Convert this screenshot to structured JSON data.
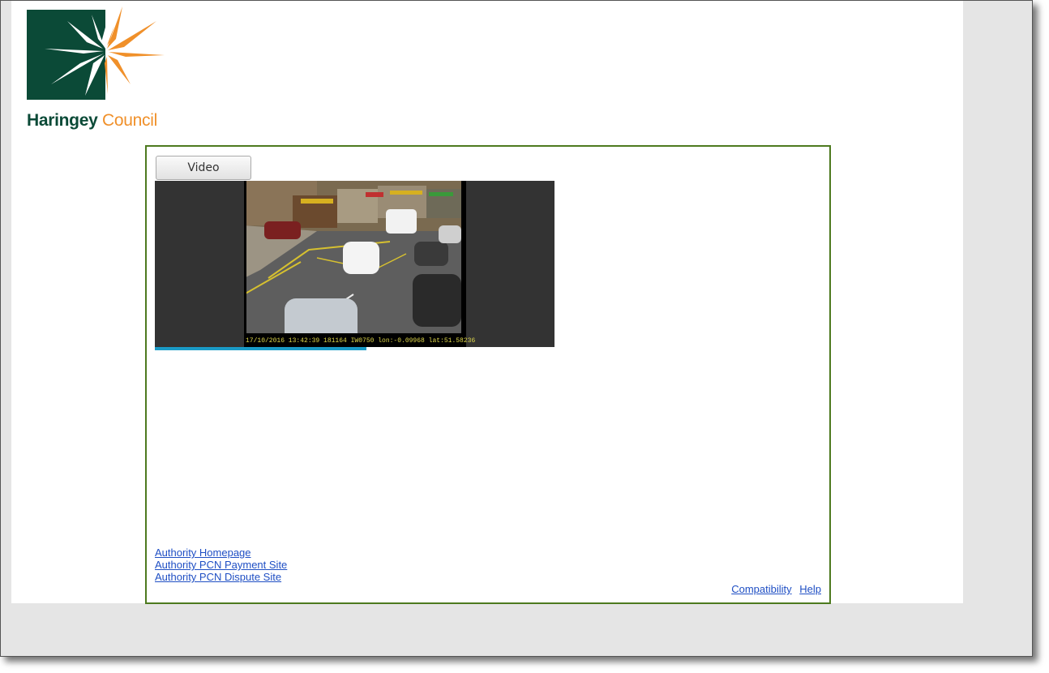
{
  "brand": {
    "name_part1": "Haringey",
    "name_part2": "Council",
    "colors": {
      "dark_green": "#0b4a37",
      "orange": "#f0902a",
      "panel_border": "#4d7a1f"
    }
  },
  "media": {
    "tab_label": "Video",
    "overlay_text": "17/10/2016 13:42:39 181164 IW0750 lon:-0.09968 lat:51.58236",
    "progress_fraction": 0.53,
    "progress_color": "#1a9bc7"
  },
  "links": {
    "authority_homepage": "Authority Homepage",
    "pcn_payment": "Authority PCN Payment Site",
    "pcn_dispute": "Authority PCN Dispute Site"
  },
  "footer": {
    "compatibility": "Compatibility",
    "help": "Help"
  }
}
